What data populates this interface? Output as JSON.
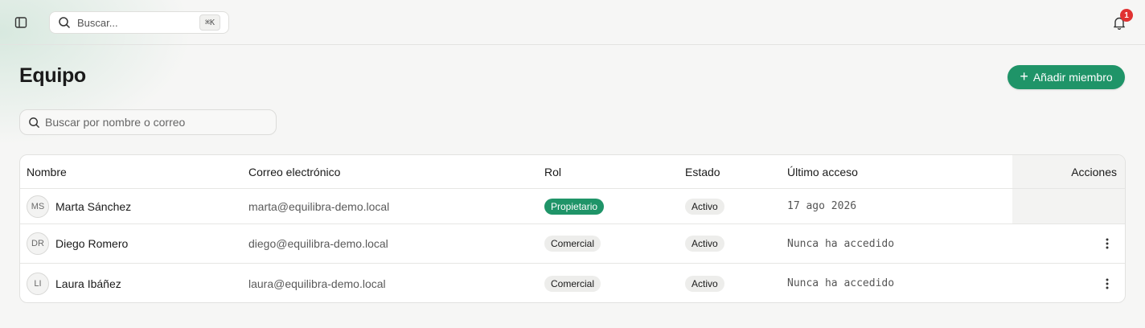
{
  "topbar": {
    "search_placeholder": "Buscar...",
    "search_shortcut": "⌘K",
    "notification_count": "1",
    "icons": [
      "sidebar-toggle-icon",
      "search-icon",
      "bell-icon"
    ]
  },
  "page": {
    "title": "Equipo",
    "add_button_icon": "+",
    "add_button_label": "Añadir miembro",
    "member_search_placeholder": "Buscar por nombre o correo"
  },
  "table": {
    "columns": {
      "name": "Nombre",
      "email": "Correo electrónico",
      "role": "Rol",
      "status": "Estado",
      "last_access": "Último acceso",
      "actions": "Acciones"
    },
    "rows": [
      {
        "initials": "MS",
        "name": "Marta Sánchez",
        "email": "marta@equilibra-demo.local",
        "role": "Propietario",
        "status": "Activo",
        "last_access": "17 ago 2026",
        "has_actions": false
      },
      {
        "initials": "DR",
        "name": "Diego Romero",
        "email": "diego@equilibra-demo.local",
        "role": "Comercial",
        "status": "Activo",
        "last_access": "Nunca ha accedido",
        "has_actions": true
      },
      {
        "initials": "LI",
        "name": "Laura Ibáñez",
        "email": "laura@equilibra-demo.local",
        "role": "Comercial",
        "status": "Activo",
        "last_access": "Nunca ha accedido",
        "has_actions": true
      }
    ]
  },
  "colors": {
    "accent": "#1f9468",
    "notification": "#e03232",
    "background": "#f6f6f5"
  }
}
